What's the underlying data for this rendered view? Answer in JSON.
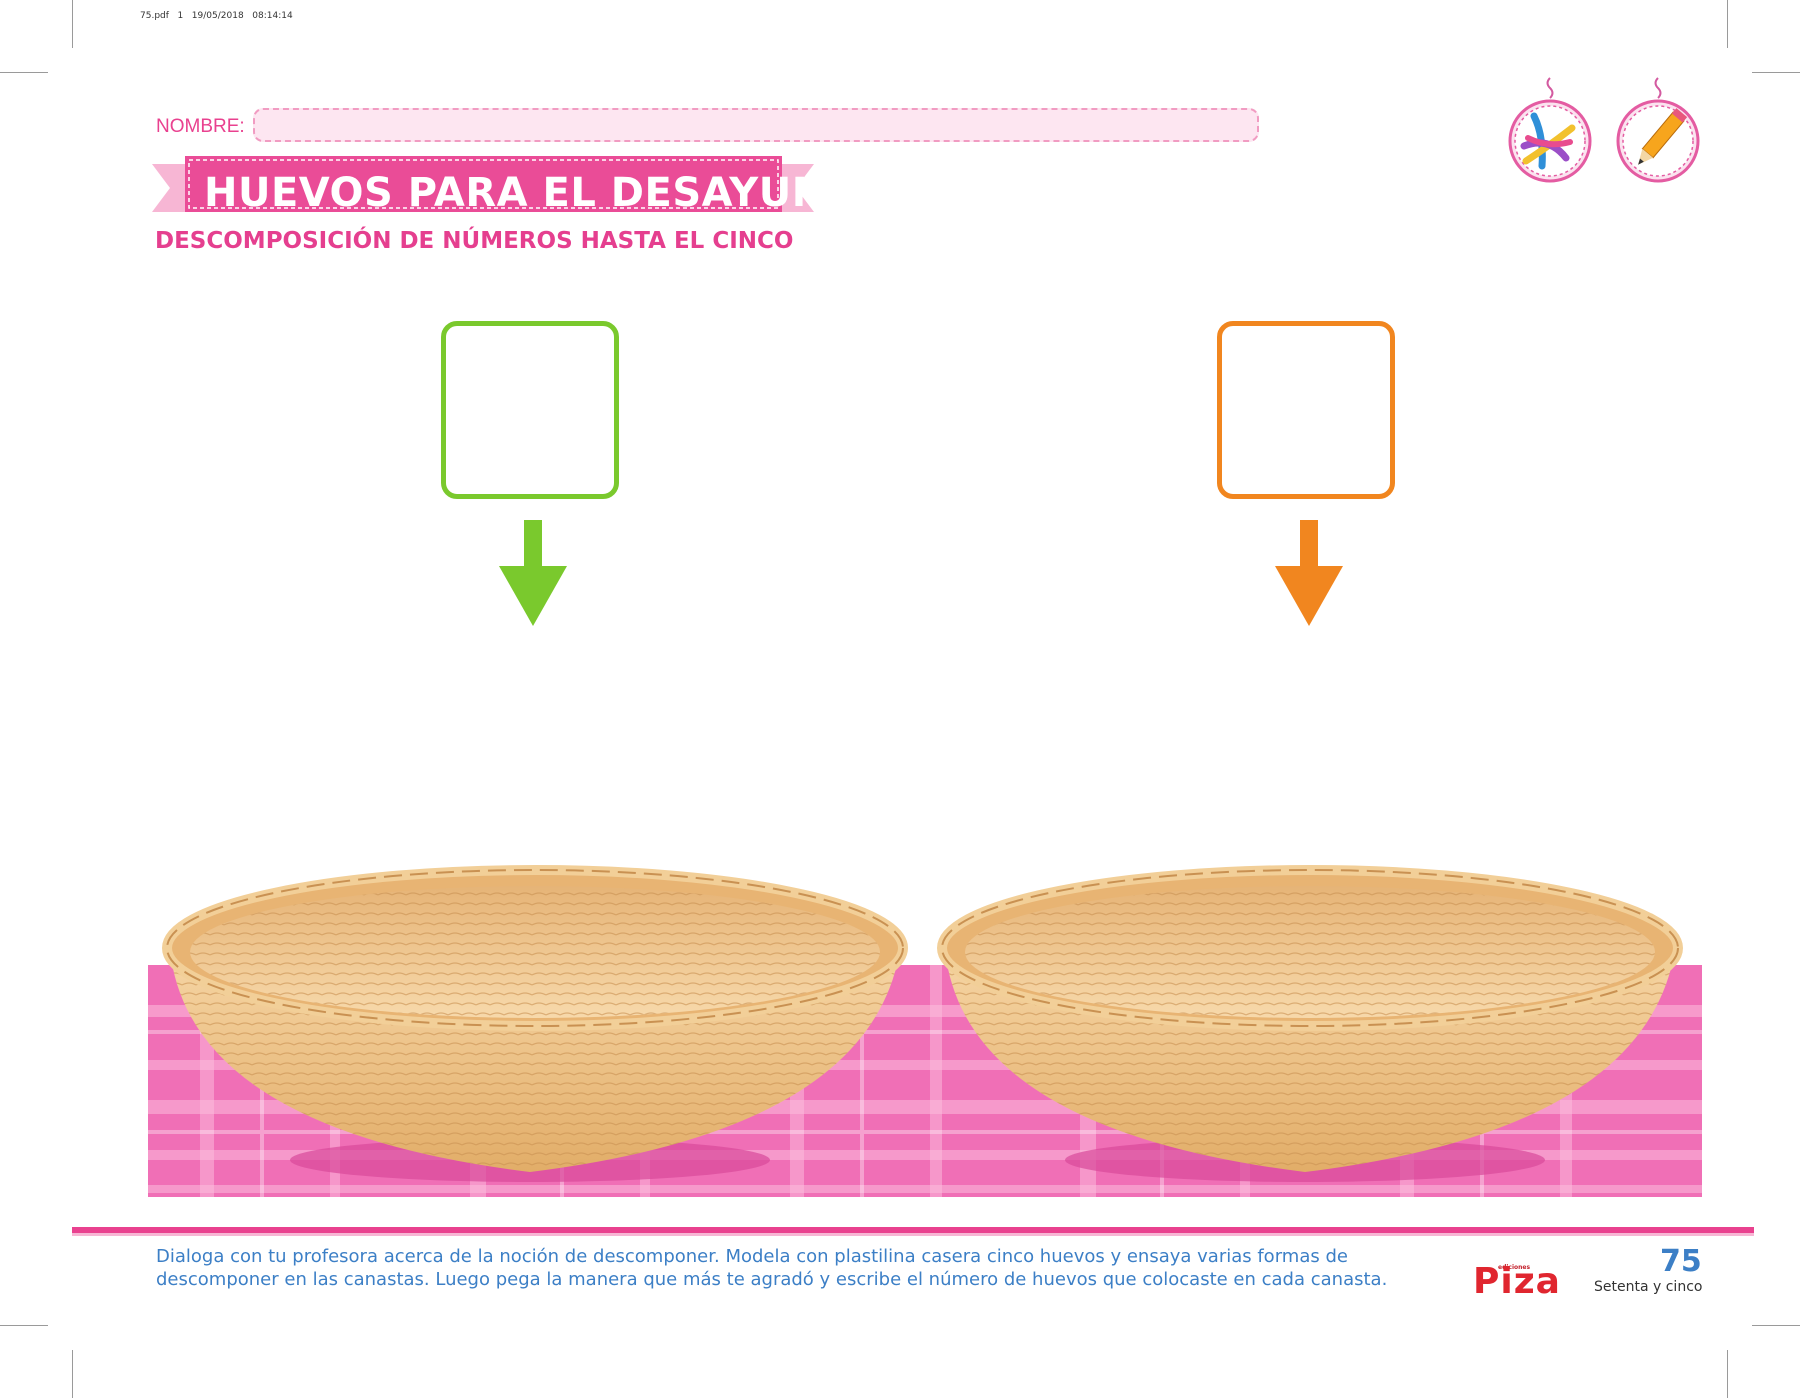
{
  "print_stamp": "75.pdf   1   19/05/2018   08:14:14",
  "header": {
    "name_label": "NOMBRE:",
    "title": "HUEVOS PARA EL DESAYUNO",
    "subtitle": "DESCOMPOSICIÓN DE NÚMEROS HASTA EL CINCO"
  },
  "material_icons": [
    "plasticine-icon",
    "pencil-icon"
  ],
  "answer_boxes": [
    {
      "name": "answer-box-left",
      "color": "#7ac92d"
    },
    {
      "name": "answer-box-right",
      "color": "#f1861f"
    }
  ],
  "scene": {
    "baskets": [
      "wicker-basket-left",
      "wicker-basket-right"
    ],
    "tablecloth_color": "#f06fb6"
  },
  "footer": {
    "instructions": "Dialoga con tu profesora acerca de la noción de descomponer. Modela con plastilina casera cinco huevos y ensaya varias formas de descomponer en las canastas. Luego pega la manera que más te agradó y escribe el número de huevos que colocaste en cada canasta.",
    "publisher_small": "ediciones",
    "publisher": "Piza",
    "page_number": "75",
    "page_words": "Setenta y cinco"
  },
  "colors": {
    "pink": "#e9418f",
    "blue": "#3c7fc6",
    "green": "#7ac92d",
    "orange": "#f1861f"
  }
}
